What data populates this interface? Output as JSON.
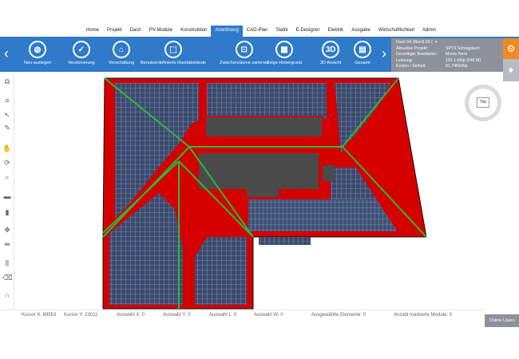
{
  "nav": {
    "items": [
      "Home",
      "Projekt",
      "Dach",
      "PV-Module",
      "Konstruktion",
      "Anordnung",
      "CAD-Plan",
      "Statik",
      "E-Designer",
      "Elektrik",
      "Ausgabe",
      "Wirtschaftlichkeit",
      "Admin"
    ],
    "active": "Anordnung"
  },
  "toolbar": {
    "tools": [
      {
        "label": "Neu auslegen",
        "icon": "globe-icon"
      },
      {
        "label": "Versionierung",
        "icon": "check-icon"
      },
      {
        "label": "Verschattung",
        "icon": "house-icon"
      },
      {
        "label": "Benutzerdefinierte Randabstände",
        "icon": "margins-icon"
      },
      {
        "label": "Zwischenräume variieren",
        "icon": "spacing-icon"
      },
      {
        "label": "Zeige Hintergrund",
        "icon": "map-icon"
      },
      {
        "label": "3D Ansicht",
        "icon": "3d-icon"
      },
      {
        "label": "Gesamt",
        "icon": "overview-icon"
      }
    ],
    "icon_glyph_3d": "3D"
  },
  "info": {
    "dach_label": "Dach 04 (Nord) 03 (",
    "rows": [
      {
        "k": "Aktuelles Projekt:",
        "v": "SPTX Schrägdach"
      },
      {
        "k": "Derzeitiger Bearbeiter:",
        "v": "Monte Nera"
      },
      {
        "k": "Leistung:",
        "v": "191.1 kWp (546 M)"
      },
      {
        "k": "Kosten / Einheit:",
        "v": "81,74€/kWp"
      }
    ]
  },
  "compass": {
    "label": "Top"
  },
  "status": {
    "cursor_x": "Kursor X: 69553",
    "cursor_y": "Kursor Y: 23011",
    "sel_x": "Auswahl X: 0",
    "sel_y": "Auswahl Y: 0",
    "sel_l": "Auswahl L: 0",
    "sel_w": "Auswahl W: 0",
    "selected_elements": "Ausgewählte Elemente: 0",
    "marked_modules": "Anzahl markierte Module: 0"
  },
  "online_users": "Online Users",
  "colors": {
    "accent": "#2f7ac9",
    "roof_red": "#d40000",
    "panel": "#3b4a6e",
    "ridge": "#2db83b"
  }
}
